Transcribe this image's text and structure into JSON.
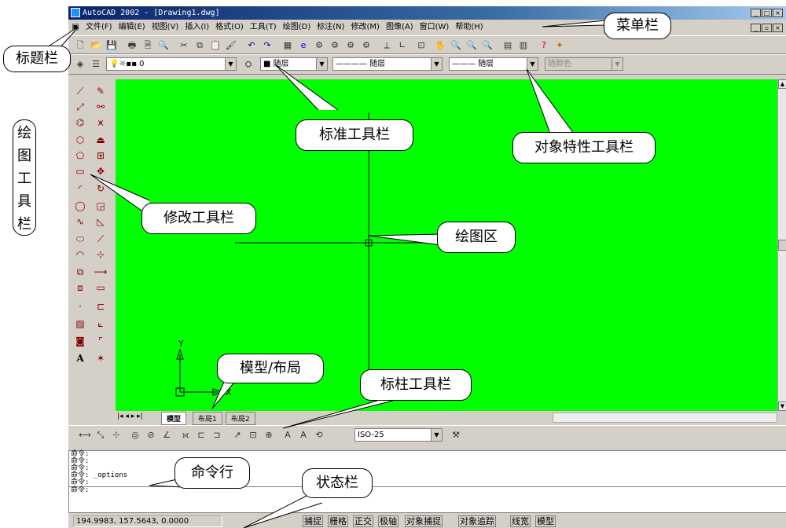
{
  "title": "AutoCAD 2002 - [Drawing1.dwg]",
  "menu": [
    "文件(F)",
    "编辑(E)",
    "视图(V)",
    "插入(I)",
    "格式(O)",
    "工具(T)",
    "绘图(D)",
    "标注(N)",
    "修改(M)",
    "图像(A)",
    "窗口(W)",
    "帮助(H)"
  ],
  "props": {
    "layer": "0",
    "color": "随层",
    "linetype": "随层",
    "lineweight": "随层",
    "plotstyle": "随颜色"
  },
  "tabs": [
    "模型",
    "布局1",
    "布局2"
  ],
  "dimstyle": "ISO-25",
  "cmd_lines": [
    "命令:",
    "命令:",
    "命令:",
    "命令: _options",
    "命令:",
    "命令:"
  ],
  "coords": "194.9983, 157.5643, 0.0000",
  "status_buttons": [
    "捕捉",
    "栅格",
    "正交",
    "极轴",
    "对象捕捉",
    "对象追踪",
    "线宽",
    "模型"
  ],
  "ucs": {
    "y": "Y",
    "x": "X"
  },
  "callouts": {
    "menubar": "菜单栏",
    "titlebar": "标题栏",
    "draw_toolbar": [
      "绘",
      "图",
      "工",
      "具",
      "栏"
    ],
    "standard_toolbar": "标准工具栏",
    "props_toolbar": "对象特性工具栏",
    "modify_toolbar": "修改工具栏",
    "drawing_area": "绘图区",
    "model_layout": "模型/布局",
    "dim_toolbar": "标柱工具栏",
    "command_line": "命令行",
    "status_bar": "状态栏"
  }
}
